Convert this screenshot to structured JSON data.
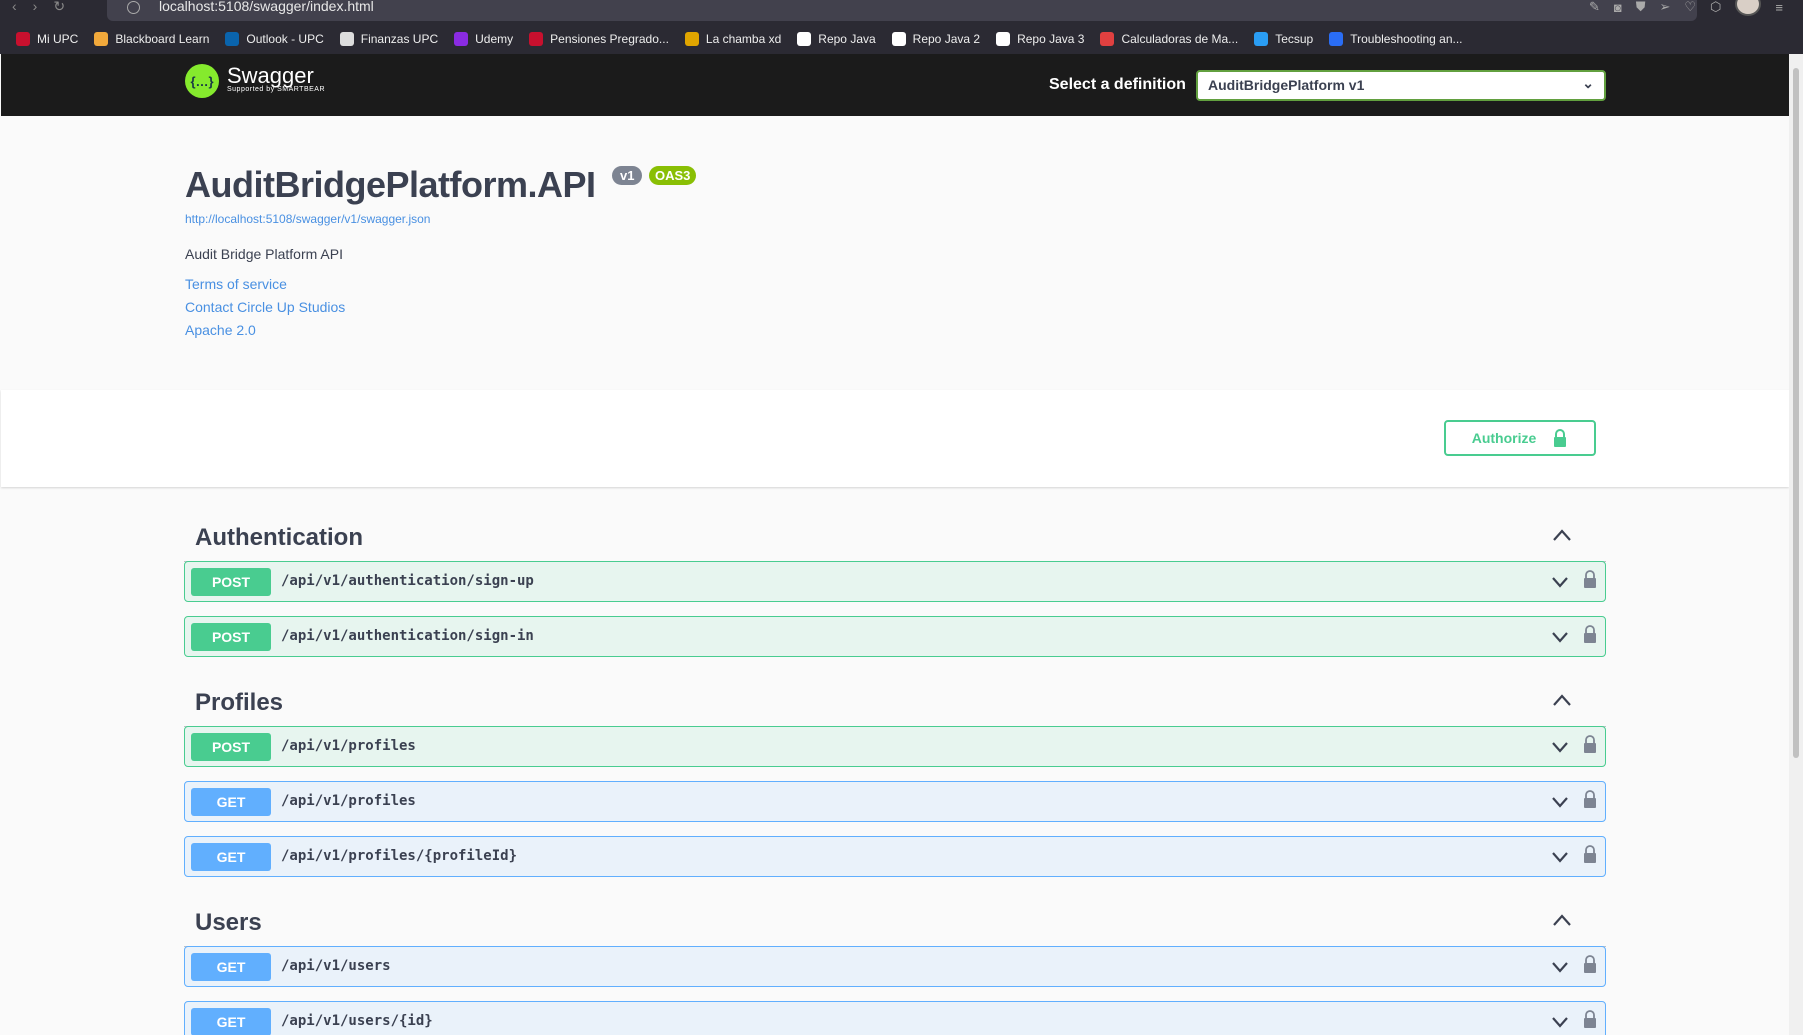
{
  "browser": {
    "url": "localhost:5108/swagger/index.html",
    "bookmarks": [
      {
        "label": "Mi UPC",
        "color": "#c8102e"
      },
      {
        "label": "Blackboard Learn",
        "color": "#f2a93b"
      },
      {
        "label": "Outlook - UPC",
        "color": "#0a64ad"
      },
      {
        "label": "Finanzas UPC",
        "color": "#dddddd"
      },
      {
        "label": "Udemy",
        "color": "#8a2be2"
      },
      {
        "label": "Pensiones Pregrado...",
        "color": "#c8102e"
      },
      {
        "label": "La chamba xd",
        "color": "#e0a500"
      },
      {
        "label": "Repo Java",
        "color": "#ffffff"
      },
      {
        "label": "Repo Java 2",
        "color": "#ffffff"
      },
      {
        "label": "Repo Java 3",
        "color": "#ffffff"
      },
      {
        "label": "Calculadoras de Ma...",
        "color": "#e04040"
      },
      {
        "label": "Tecsup",
        "color": "#2a9df4"
      },
      {
        "label": "Troubleshooting an...",
        "color": "#2a6df4"
      }
    ]
  },
  "topbar": {
    "logo_name": "Swagger",
    "logo_sub": "Supported by SMARTBEAR",
    "select_label": "Select a definition",
    "selected_definition": "AuditBridgePlatform v1"
  },
  "info": {
    "title": "AuditBridgePlatform.API",
    "version_badge": "v1",
    "oas_badge": "OAS3",
    "spec_url": "http://localhost:5108/swagger/v1/swagger.json",
    "description": "Audit Bridge Platform API",
    "terms": "Terms of service",
    "contact": "Contact Circle Up Studios",
    "license": "Apache 2.0"
  },
  "authorize_label": "Authorize",
  "tags": [
    {
      "name": "Authentication",
      "ops": [
        {
          "method": "POST",
          "path": "/api/v1/authentication/sign-up"
        },
        {
          "method": "POST",
          "path": "/api/v1/authentication/sign-in"
        }
      ]
    },
    {
      "name": "Profiles",
      "ops": [
        {
          "method": "POST",
          "path": "/api/v1/profiles"
        },
        {
          "method": "GET",
          "path": "/api/v1/profiles"
        },
        {
          "method": "GET",
          "path": "/api/v1/profiles/{profileId}"
        }
      ]
    },
    {
      "name": "Users",
      "ops": [
        {
          "method": "GET",
          "path": "/api/v1/users"
        },
        {
          "method": "GET",
          "path": "/api/v1/users/{id}"
        }
      ]
    }
  ],
  "colors": {
    "post": "#49cc90",
    "get": "#61affe",
    "topbar": "#1b1b1b"
  }
}
